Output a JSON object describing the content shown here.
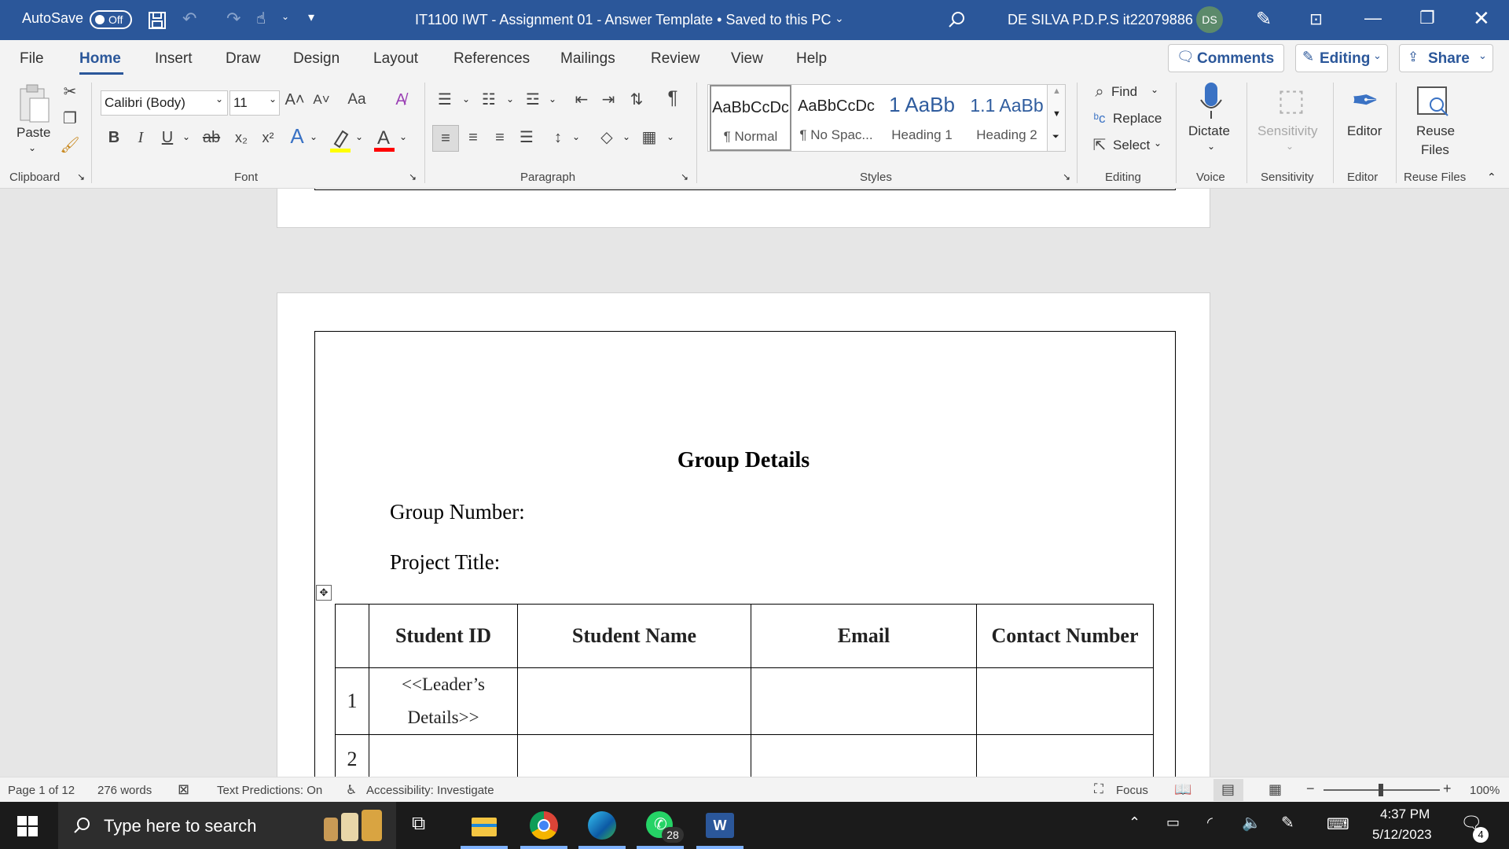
{
  "titlebar": {
    "autosave_label": "AutoSave",
    "autosave_state": "Off",
    "doc_title": "IT1100 IWT - Assignment 01 - Answer Template • Saved to this PC",
    "user_name": "DE SILVA P.D.P.S it22079886",
    "user_initials": "DS",
    "colors": {
      "bar": "#2b579a"
    }
  },
  "menu": {
    "tabs": [
      "File",
      "Home",
      "Insert",
      "Draw",
      "Design",
      "Layout",
      "References",
      "Mailings",
      "Review",
      "View",
      "Help"
    ],
    "active_tab": "Home",
    "comments_label": "Comments",
    "editing_label": "Editing",
    "share_label": "Share"
  },
  "ribbon": {
    "clipboard": {
      "paste_label": "Paste",
      "group_label": "Clipboard"
    },
    "font": {
      "font_name": "Calibri (Body)",
      "font_size": "11",
      "group_label": "Font",
      "case_label": "Aa",
      "bold": "B",
      "italic": "I",
      "underline": "U",
      "strike": "ab",
      "highlight_color": "#ffff00",
      "font_color": "#ff0000"
    },
    "paragraph": {
      "group_label": "Paragraph"
    },
    "styles": {
      "group_label": "Styles",
      "items": [
        {
          "preview": "AaBbCcDc",
          "name": "¶ Normal"
        },
        {
          "preview": "AaBbCcDc",
          "name": "¶ No Spac..."
        },
        {
          "preview": "1  AaBb",
          "name": "Heading 1"
        },
        {
          "preview": "1.1  AaBb",
          "name": "Heading 2"
        }
      ]
    },
    "editing": {
      "find": "Find",
      "replace": "Replace",
      "select": "Select",
      "group_label": "Editing"
    },
    "voice": {
      "dictate": "Dictate",
      "group_label": "Voice"
    },
    "sensitivity": {
      "label": "Sensitivity",
      "group_label": "Sensitivity"
    },
    "editor": {
      "label": "Editor",
      "group_label": "Editor"
    },
    "reuse": {
      "label_line1": "Reuse",
      "label_line2": "Files",
      "group_label": "Reuse Files"
    }
  },
  "document": {
    "heading": "Group Details",
    "group_number_label": "Group Number:",
    "project_title_label": "Project Title:",
    "table": {
      "headers": [
        "",
        "Student ID",
        "Student Name",
        "Email",
        "Contact Number"
      ],
      "rows": [
        {
          "no": "1",
          "id_line1": "<<Leader’s",
          "id_line2": "Details>>"
        },
        {
          "no": "2",
          "id_line1": "",
          "id_line2": ""
        }
      ]
    }
  },
  "statusbar": {
    "page": "Page 1 of 12",
    "words": "276 words",
    "text_predictions": "Text Predictions: On",
    "accessibility": "Accessibility: Investigate",
    "focus": "Focus",
    "zoom": "100%",
    "zoom_level_percent": 100
  },
  "taskbar": {
    "search_placeholder": "Type here to search",
    "whatsapp_badge": "28",
    "time": "4:37 PM",
    "date": "5/12/2023",
    "notification_count": "4"
  }
}
